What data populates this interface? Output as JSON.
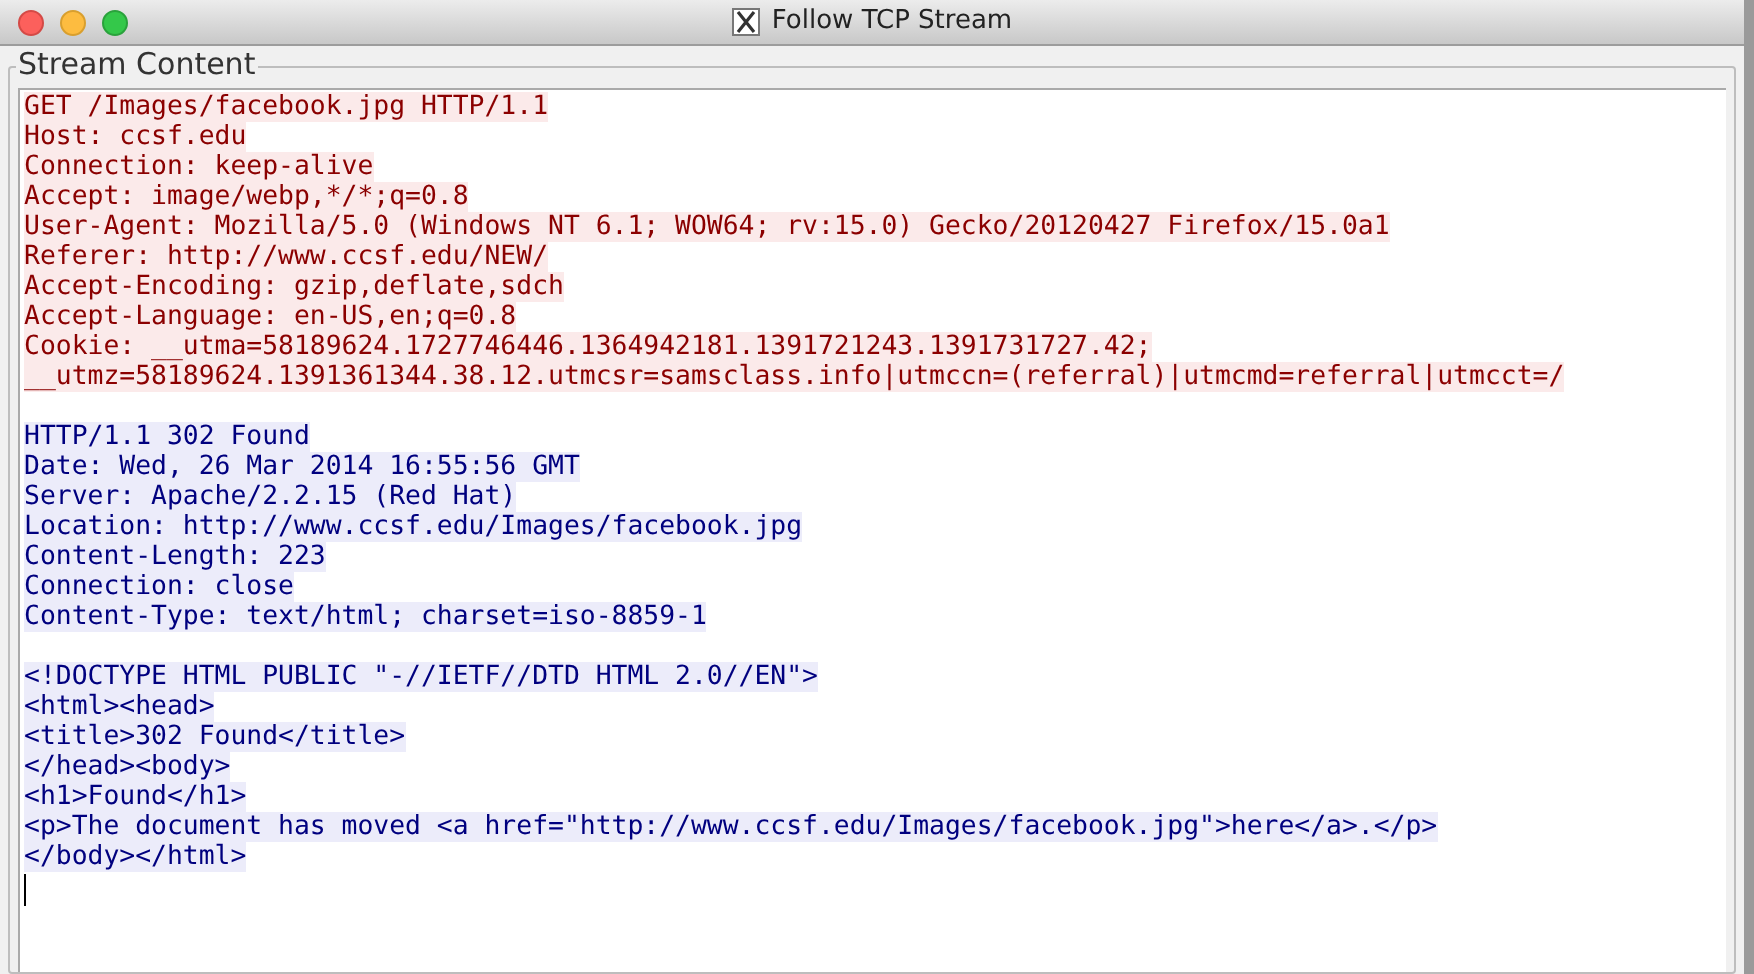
{
  "window": {
    "title": "Follow TCP Stream"
  },
  "group": {
    "label": "Stream Content"
  },
  "stream": [
    {
      "kind": "client",
      "lines": [
        "GET /Images/facebook.jpg HTTP/1.1",
        "Host: ccsf.edu",
        "Connection: keep-alive",
        "Accept: image/webp,*/*;q=0.8",
        "User-Agent: Mozilla/5.0 (Windows NT 6.1; WOW64; rv:15.0) Gecko/20120427 Firefox/15.0a1",
        "Referer: http://www.ccsf.edu/NEW/",
        "Accept-Encoding: gzip,deflate,sdch",
        "Accept-Language: en-US,en;q=0.8",
        "Cookie: __utma=58189624.1727746446.1364942181.1391721243.1391731727.42;",
        "__utmz=58189624.1391361344.38.12.utmcsr=samsclass.info|utmccn=(referral)|utmcmd=referral|utmcct=/"
      ]
    },
    {
      "kind": "server",
      "lines": [
        "HTTP/1.1 302 Found",
        "Date: Wed, 26 Mar 2014 16:55:56 GMT",
        "Server: Apache/2.2.15 (Red Hat)",
        "Location: http://www.ccsf.edu/Images/facebook.jpg",
        "Content-Length: 223",
        "Connection: close",
        "Content-Type: text/html; charset=iso-8859-1"
      ]
    },
    {
      "kind": "server",
      "lines": [
        "<!DOCTYPE HTML PUBLIC \"-//IETF//DTD HTML 2.0//EN\">",
        "<html><head>",
        "<title>302 Found</title>",
        "</head><body>",
        "<h1>Found</h1>",
        "<p>The document has moved <a href=\"http://www.ccsf.edu/Images/facebook.jpg\">here</a>.</p>",
        "</body></html>"
      ]
    }
  ]
}
